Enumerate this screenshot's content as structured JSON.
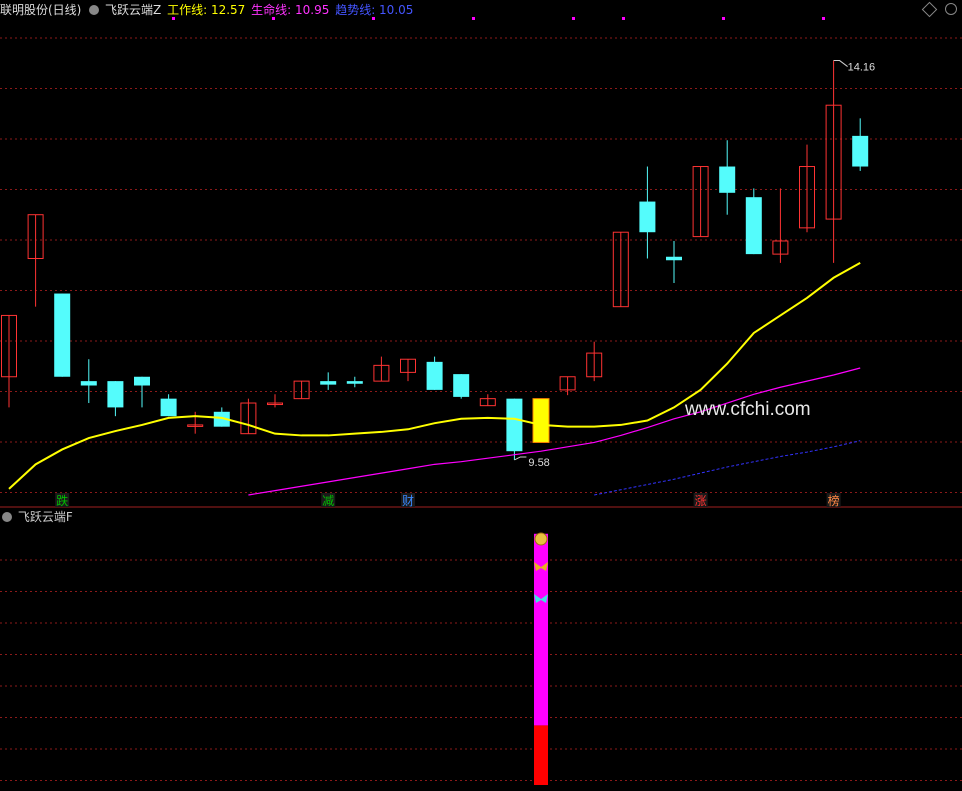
{
  "header": {
    "stock": "联明股份(日线)",
    "indicator": "飞跃云端Z",
    "work_label": "工作线: 12.57",
    "life_label": "生命线: 10.95",
    "trend_label": "趋势线: 10.05"
  },
  "sub_header": {
    "indicator": "飞跃云端F"
  },
  "watermark": "www.cfchi.com",
  "colors": {
    "up": "#ff3333",
    "down": "#54fcfc",
    "work_line": "#ffff00",
    "life_line": "#ff00ff",
    "trend_line": "#3333ff",
    "grid": "#8b1a1a",
    "highlight": "#ffff00",
    "bar_magenta": "#ff00ff",
    "bar_red": "#ff0000"
  },
  "chart_data": {
    "type": "candlestick",
    "ylim": [
      9.2,
      14.6
    ],
    "max_label": "14.16",
    "min_label": "9.58",
    "candles": [
      {
        "o": 10.55,
        "c": 11.25,
        "h": 11.25,
        "l": 10.2
      },
      {
        "o": 11.9,
        "c": 12.4,
        "h": 12.4,
        "l": 11.35
      },
      {
        "o": 11.5,
        "c": 10.55,
        "h": 11.5,
        "l": 10.55
      },
      {
        "o": 10.5,
        "c": 10.45,
        "h": 10.75,
        "l": 10.25
      },
      {
        "o": 10.5,
        "c": 10.2,
        "h": 10.5,
        "l": 10.1
      },
      {
        "o": 10.55,
        "c": 10.45,
        "h": 10.55,
        "l": 10.2
      },
      {
        "o": 10.3,
        "c": 10.1,
        "h": 10.35,
        "l": 10.1
      },
      {
        "o": 10.0,
        "c": 10.0,
        "h": 10.15,
        "l": 9.9
      },
      {
        "o": 10.15,
        "c": 9.98,
        "h": 10.2,
        "l": 9.98
      },
      {
        "o": 9.9,
        "c": 10.25,
        "h": 10.3,
        "l": 9.9
      },
      {
        "o": 10.25,
        "c": 10.25,
        "h": 10.35,
        "l": 10.2
      },
      {
        "o": 10.3,
        "c": 10.5,
        "h": 10.5,
        "l": 10.3
      },
      {
        "o": 10.5,
        "c": 10.46,
        "h": 10.6,
        "l": 10.4
      },
      {
        "o": 10.5,
        "c": 10.47,
        "h": 10.55,
        "l": 10.43
      },
      {
        "o": 10.5,
        "c": 10.68,
        "h": 10.78,
        "l": 10.5
      },
      {
        "o": 10.6,
        "c": 10.75,
        "h": 10.75,
        "l": 10.5
      },
      {
        "o": 10.72,
        "c": 10.4,
        "h": 10.78,
        "l": 10.4
      },
      {
        "o": 10.58,
        "c": 10.32,
        "h": 10.58,
        "l": 10.3
      },
      {
        "o": 10.22,
        "c": 10.3,
        "h": 10.35,
        "l": 10.22
      },
      {
        "o": 10.3,
        "c": 9.7,
        "h": 10.3,
        "l": 9.6
      },
      {
        "o": 10.3,
        "c": 9.8,
        "h": 10.3,
        "l": 9.8
      },
      {
        "o": 10.4,
        "c": 10.55,
        "h": 10.55,
        "l": 10.34
      },
      {
        "o": 10.55,
        "c": 10.82,
        "h": 10.95,
        "l": 10.5
      },
      {
        "o": 11.35,
        "c": 12.2,
        "h": 12.2,
        "l": 11.35
      },
      {
        "o": 12.55,
        "c": 12.2,
        "h": 12.95,
        "l": 11.9
      },
      {
        "o": 11.92,
        "c": 11.88,
        "h": 12.1,
        "l": 11.62
      },
      {
        "o": 12.15,
        "c": 12.95,
        "h": 12.95,
        "l": 12.15
      },
      {
        "o": 12.95,
        "c": 12.65,
        "h": 13.25,
        "l": 12.4
      },
      {
        "o": 12.6,
        "c": 11.95,
        "h": 12.7,
        "l": 11.95
      },
      {
        "o": 11.95,
        "c": 12.1,
        "h": 12.7,
        "l": 11.85
      },
      {
        "o": 12.25,
        "c": 12.95,
        "h": 13.2,
        "l": 12.2
      },
      {
        "o": 12.35,
        "c": 13.65,
        "h": 14.16,
        "l": 11.85
      },
      {
        "o": 13.3,
        "c": 12.95,
        "h": 13.5,
        "l": 12.9
      }
    ],
    "highlight_index": 20,
    "work_line": [
      9.27,
      9.55,
      9.72,
      9.85,
      9.93,
      10.0,
      10.08,
      10.1,
      10.08,
      10.0,
      9.9,
      9.88,
      9.88,
      9.9,
      9.92,
      9.95,
      10.02,
      10.07,
      10.08,
      10.07,
      10.0,
      9.98,
      9.98,
      10.0,
      10.05,
      10.2,
      10.4,
      10.7,
      11.05,
      11.25,
      11.45,
      11.68,
      11.85
    ],
    "life_line": [
      null,
      null,
      null,
      null,
      null,
      null,
      null,
      null,
      null,
      9.2,
      9.25,
      9.3,
      9.35,
      9.4,
      9.45,
      9.5,
      9.55,
      9.58,
      9.62,
      9.66,
      9.7,
      9.75,
      9.8,
      9.88,
      9.97,
      10.07,
      10.15,
      10.25,
      10.35,
      10.43,
      10.5,
      10.57,
      10.65
    ],
    "trend_line": [
      null,
      null,
      null,
      null,
      null,
      null,
      null,
      null,
      null,
      null,
      null,
      null,
      null,
      null,
      null,
      null,
      null,
      null,
      null,
      null,
      null,
      null,
      9.2,
      9.26,
      9.32,
      9.38,
      9.45,
      9.52,
      9.58,
      9.64,
      9.69,
      9.75,
      9.82
    ],
    "markers": [
      {
        "index": 2,
        "label": "跌",
        "color": "#00c000"
      },
      {
        "index": 12,
        "label": "减",
        "color": "#00c000"
      },
      {
        "index": 15,
        "label": "财",
        "color": "#3a8aff"
      },
      {
        "index": 26,
        "label": "涨",
        "color": "#ff3030"
      },
      {
        "index": 31,
        "label": "榜",
        "color": "#ff8844"
      }
    ],
    "sub_bar": {
      "index": 20,
      "magenta_top": 0.97,
      "red_top": 0.23,
      "icons": [
        "money-bag",
        "butterfly-gold",
        "butterfly-cyan"
      ]
    }
  }
}
